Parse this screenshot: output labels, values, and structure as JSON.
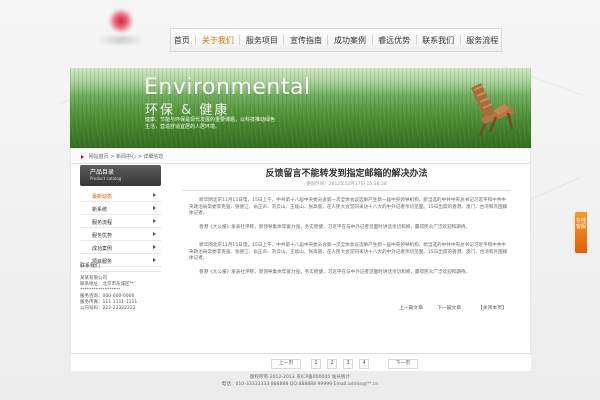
{
  "site": {
    "nav": [
      {
        "label": "首页"
      },
      {
        "label": "关于我们",
        "active": true
      },
      {
        "label": "服务项目"
      },
      {
        "label": "宣传指南"
      },
      {
        "label": "成功案例"
      },
      {
        "label": "睿远优势"
      },
      {
        "label": "联系我们"
      },
      {
        "label": "服务流程"
      }
    ]
  },
  "banner": {
    "title": "Environmental",
    "subtitle": "环保 & 健康",
    "copy": "健康、节能与环保是现代发展的重要课题，以科技推动绿色生活，营造舒适宜居的人居环境。"
  },
  "breadcrumb": {
    "home": "网站首页",
    "section": "新闻中心",
    "current": "详细信息"
  },
  "sidebar": {
    "title": "产品目录",
    "subtitle": "Product catalog",
    "items": [
      {
        "label": "最新动态",
        "active": true
      },
      {
        "label": "新系统"
      },
      {
        "label": "服务流程"
      },
      {
        "label": "服务优势"
      },
      {
        "label": "成功案例"
      },
      {
        "label": "项目服务"
      }
    ]
  },
  "contact": {
    "title": "联系我们",
    "company": "某某有限公司",
    "address": "联系地址：北京市东城区**",
    "zip": "******************",
    "phone": "服务咨询：000-000-0000",
    "fax": "服务传真：111-1111-1111",
    "mobile": "公司号码：222-22222222"
  },
  "article": {
    "title": "反馈留言不能转发到指定邮箱的解决办法",
    "meta": "更新时间：2012年12月17日 15:38:38",
    "paragraphs": [
      "新华网北京11月15日电，15日上午，中共第十八届中央委员会第一次全体会议选举产生新一届中央领导机构，新当选的中共中央总书记习近平和中共中央政治局常委李克强、张德江、俞正声、刘云山、王岐山、张高丽，在人民大会堂同采访十八大的中外记者亲切见面。15日出席的香港、澳门、台湾和外国媒体记者。",
      "香港《大公报》发表社评称，新领导集体年富力强，务实稳健，习近平在与中外记者见面时讲话亲切和婉，赢得民众广泛欢迎和期待。",
      "新华网北京11月15日电，15日上午，中共第十八届中央委员会第一次全体会议选举产生新一届中央领导机构，新当选的中共中央总书记习近平和中共中央政治局常委李克强、张德江、俞正声、刘云山、王岐山、张高丽，在人民大会堂同采访十八大的中外记者亲切见面。15日出席的香港、澳门、台湾和外国媒体记者。",
      "香港《大公报》发表社评称，新领导集体年富力强，务实稳健，习近平在与中外记者见面时讲话亲切和婉，赢得民众广泛欢迎和期待。"
    ],
    "prev": "上一篇文章",
    "next": "下一篇文章",
    "close": "【关闭本页】"
  },
  "pager": {
    "prev": "上一页",
    "pages": [
      "1",
      "2",
      "3",
      "4"
    ],
    "next": "下一页"
  },
  "footer": {
    "line1": "版权所有 2012-2013 京ICP备000000 站长统计",
    "line2": "电话：010-33333333 888888 QQ:888888 99999 Email:admin@**.cn"
  },
  "floating": {
    "label": "在线客服"
  }
}
